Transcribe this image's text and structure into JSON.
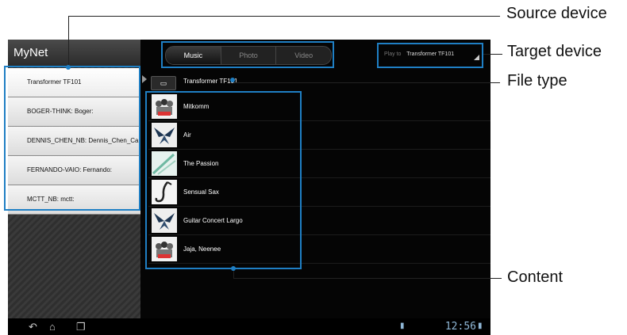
{
  "app": {
    "title": "MyNet"
  },
  "devices": [
    {
      "label": "Transformer TF101",
      "selected": true
    },
    {
      "label": "BOGER-THINK: Boger:"
    },
    {
      "label": "DENNIS_CHEN_NB: Dennis_Chen_Ca..."
    },
    {
      "label": "FERNANDO-VAIO: Fernando:"
    },
    {
      "label": "MCTT_NB: mctt:"
    }
  ],
  "tabs": [
    {
      "label": "Music",
      "active": true
    },
    {
      "label": "Photo"
    },
    {
      "label": "Video"
    }
  ],
  "play_to": {
    "label": "Play to",
    "device": "Transformer TF101"
  },
  "file_path": {
    "device": "Transformer TF101"
  },
  "content": [
    {
      "title": "Mitkomm",
      "thumb": "album-art-crowd"
    },
    {
      "title": "Air",
      "thumb": "album-art-wings"
    },
    {
      "title": "The Passion",
      "thumb": "album-art-green"
    },
    {
      "title": "Sensual Sax",
      "thumb": "album-art-sax"
    },
    {
      "title": "Guitar Concert Largo",
      "thumb": "album-art-wings"
    },
    {
      "title": "Jaja, Neenee",
      "thumb": "album-art-crowd"
    }
  ],
  "status": {
    "time": "12:56"
  },
  "annotations": {
    "source_device": "Source device",
    "target_device": "Target device",
    "file_type": "File type",
    "content": "Content"
  },
  "colors": {
    "highlight": "#1f7fc4",
    "background": "#050505"
  }
}
